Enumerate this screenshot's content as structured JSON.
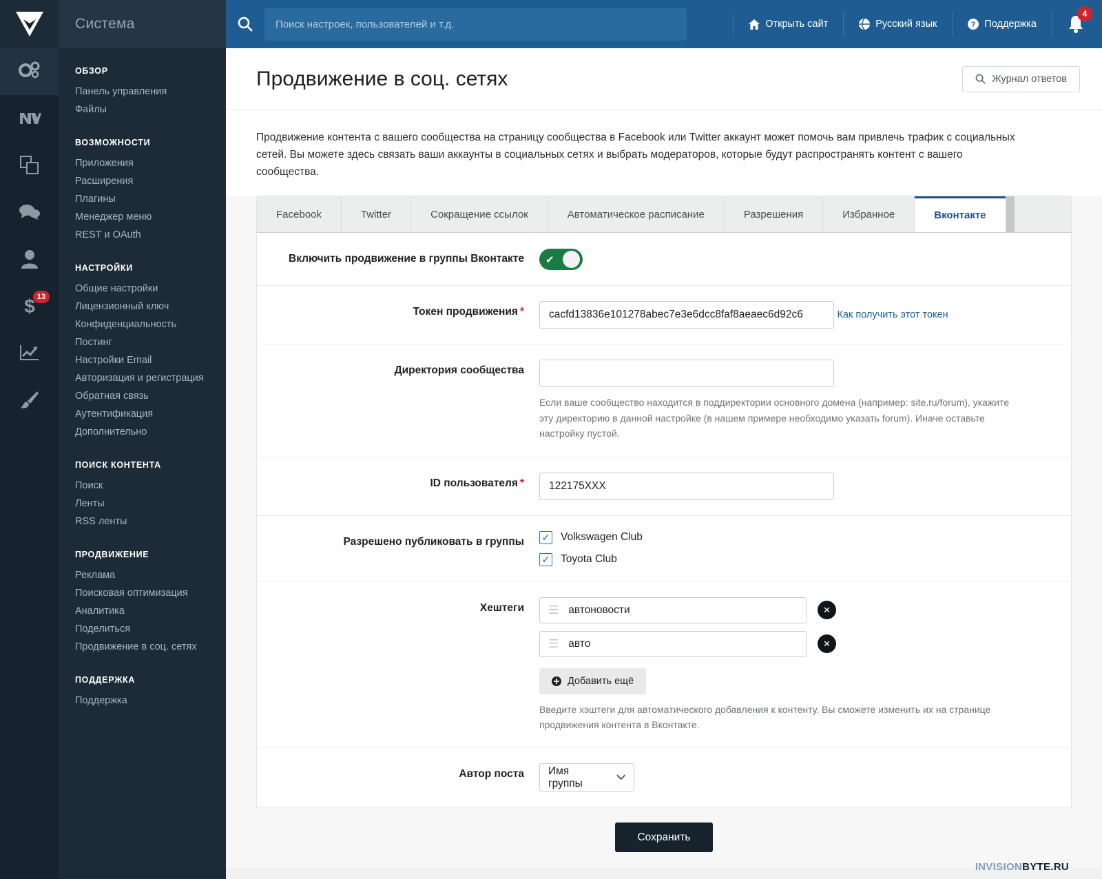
{
  "rail": {
    "logo_name": "invision-logo",
    "items": [
      {
        "name": "system-settings-icon",
        "active": true,
        "badge": ""
      },
      {
        "name": "vk-icon",
        "active": false,
        "badge": ""
      },
      {
        "name": "pages-icon",
        "active": false,
        "badge": ""
      },
      {
        "name": "chat-bubbles-icon",
        "active": false,
        "badge": ""
      },
      {
        "name": "user-icon",
        "active": false,
        "badge": ""
      },
      {
        "name": "dollar-icon",
        "active": false,
        "badge": "13"
      },
      {
        "name": "analytics-chart-icon",
        "active": false,
        "badge": ""
      },
      {
        "name": "paintbrush-icon",
        "active": false,
        "badge": ""
      }
    ]
  },
  "sidebar": {
    "title": "Система",
    "groups": [
      {
        "title": "ОБЗОР",
        "items": [
          "Панель управления",
          "Файлы"
        ]
      },
      {
        "title": "ВОЗМОЖНОСТИ",
        "items": [
          "Приложения",
          "Расширения",
          "Плагины",
          "Менеджер меню",
          "REST и OAuth"
        ]
      },
      {
        "title": "НАСТРОЙКИ",
        "items": [
          "Общие настройки",
          "Лицензионный ключ",
          "Конфиденциальность",
          "Постинг",
          "Настройки Email",
          "Авторизация и регистрация",
          "Обратная связь",
          "Аутентификация",
          "Дополнительно"
        ]
      },
      {
        "title": "ПОИСК КОНТЕНТА",
        "items": [
          "Поиск",
          "Ленты",
          "RSS ленты"
        ]
      },
      {
        "title": "ПРОДВИЖЕНИЕ",
        "items": [
          "Реклама",
          "Поисковая оптимизация",
          "Аналитика",
          "Поделиться",
          "Продвижение в соц. сетях"
        ]
      },
      {
        "title": "ПОДДЕРЖКА",
        "items": [
          "Поддержка"
        ]
      }
    ]
  },
  "topbar": {
    "search_placeholder": "Поиск настроек, пользователей и т.д.",
    "search_value": "",
    "open_site": "Открыть сайт",
    "language": "Русский язык",
    "support": "Поддержка",
    "notifications_count": "4"
  },
  "page": {
    "title": "Продвижение в соц. сетях",
    "log_button": "Журнал ответов",
    "intro": "Продвижение контента с вашего сообщества на страницу сообщества в Facebook или Twitter аккаунт может помочь вам привлечь трафик с социальных сетей. Вы можете здесь связать ваши аккаунты в социальных сетях и выбрать модераторов, которые будут распространять контент с вашего сообщества."
  },
  "tabs": [
    {
      "label": "Facebook",
      "active": false
    },
    {
      "label": "Twitter",
      "active": false
    },
    {
      "label": "Сокращение ссылок",
      "active": false
    },
    {
      "label": "Автоматическое расписание",
      "active": false
    },
    {
      "label": "Разрешения",
      "active": false
    },
    {
      "label": "Избранное",
      "active": false
    },
    {
      "label": "Вконтакте",
      "active": true
    }
  ],
  "form": {
    "enable_label": "Включить продвижение в группы Вконтакте",
    "enable_value": true,
    "token_label": "Токен продвижения",
    "token_value": "cacfd13836e101278abec7e3e6dcc8faf8aeaec6d92c6",
    "token_link": "Как получить этот токен",
    "directory_label": "Директория сообщества",
    "directory_value": "",
    "directory_hint": "Если ваше сообщество находится в поддиректории основного домена (например: site.ru/forum), укажите эту директорию в данной настройке (в нашем примере необходимо указать forum). Иначе оставьте настройку пустой.",
    "userid_label": "ID пользователя",
    "userid_value": "122175XXX",
    "groups_label": "Разрешено публиковать в группы",
    "groups": [
      {
        "label": "Volkswagen Club",
        "checked": true
      },
      {
        "label": "Toyota Club",
        "checked": true
      }
    ],
    "hashtags_label": "Хештеги",
    "hashtags": [
      "автоновости",
      "авто"
    ],
    "add_more": "Добавить ещё",
    "hashtags_hint": "Введите хэштеги для автоматического добавления к контенту. Вы сможете изменить их на странице продвижения контента в Вконтакте.",
    "author_label": "Автор поста",
    "author_value": "Имя группы"
  },
  "footer": {
    "save": "Сохранить",
    "watermark_a": "INVISION",
    "watermark_b": "BYTE.RU"
  },
  "colors": {
    "rail_bg": "#16232e",
    "sidebar_bg": "#1d2b38",
    "topbar_blue": "#1e5c92",
    "accent_blue": "#1d4f91",
    "toggle_green": "#1a7a44",
    "badge_red": "#d0232b"
  }
}
